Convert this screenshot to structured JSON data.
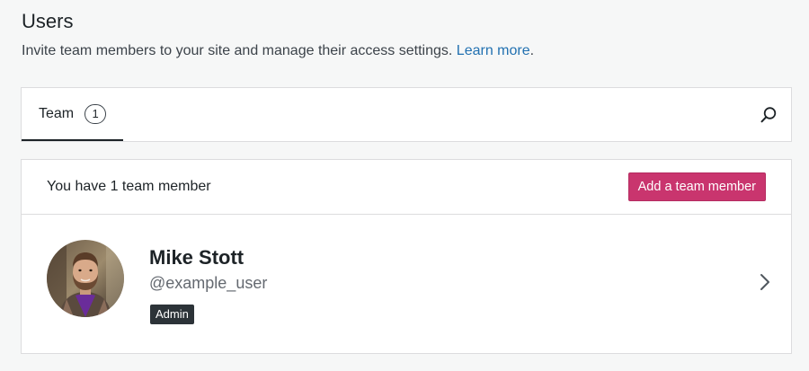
{
  "header": {
    "title": "Users",
    "subtitle": "Invite team members to your site and manage their access settings.",
    "learn_more": "Learn more",
    "subtitle_end": "."
  },
  "tabs": {
    "team_label": "Team",
    "team_count": "1",
    "search_icon": "search-icon"
  },
  "members": {
    "count_text": "You have 1 team member",
    "add_button": "Add a team member",
    "items": [
      {
        "name": "Mike Stott",
        "username": "@example_user",
        "role": "Admin"
      }
    ]
  },
  "colors": {
    "accent": "#c9356e",
    "link": "#2271b1",
    "badge": "#2c3338"
  }
}
